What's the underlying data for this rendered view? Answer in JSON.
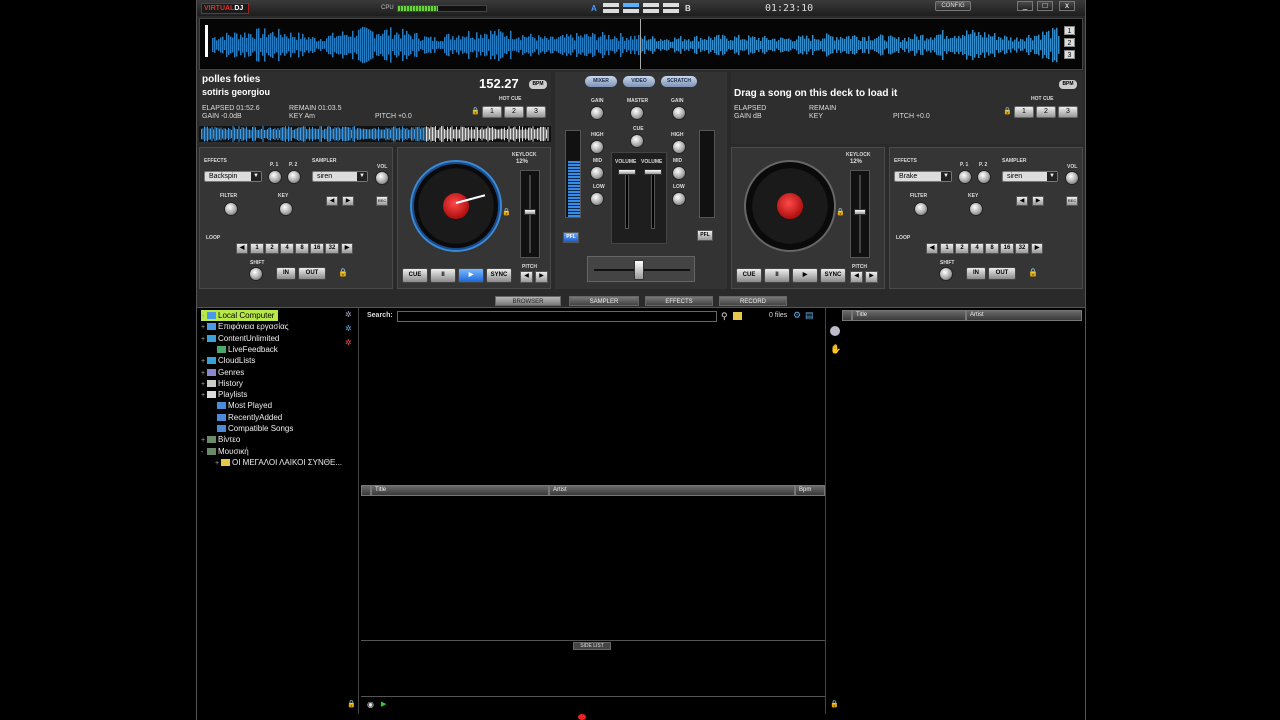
{
  "app": {
    "logo_part1": "VIRTUAL",
    "logo_part2": "DJ",
    "cpu_label": "CPU",
    "cpu_load": 0.45,
    "deck_a_label": "A",
    "deck_b_label": "B",
    "clock": "01:23:10",
    "config_label": "CONFIG",
    "minimize": "_",
    "maximize": "□",
    "close": "x"
  },
  "waveform": {
    "buttons": [
      "1",
      "2",
      "3"
    ]
  },
  "deck_left": {
    "title": "polles foties",
    "artist": "sotiris georgiou",
    "bpm": "152.27",
    "bpm_badge": "BPM",
    "elapsed": "ELAPSED 01:52.6",
    "remain": "REMAIN 01:03.5",
    "gain": "GAIN -0.0dB",
    "key": "KEY Am",
    "pitch": "PITCH +0.0",
    "hot_cue_label": "HOT CUE",
    "hot_cues": [
      "1",
      "2",
      "3"
    ],
    "effects_label": "EFFECTS",
    "p1": "P. 1",
    "p2": "P. 2",
    "effect": "Backspin",
    "sampler_label": "SAMPLER",
    "vol_label": "VOL",
    "sample": "siren",
    "rec": "REC",
    "filter_label": "FILTER",
    "key_label": "KEY",
    "loop_label": "LOOP",
    "loop_values": [
      "1",
      "2",
      "4",
      "8",
      "16",
      "32"
    ],
    "shift_label": "SHIFT",
    "in_label": "IN",
    "out_label": "OUT",
    "keylock_label": "KEYLOCK",
    "keylock_value": "12%",
    "pitch_label": "PITCH",
    "cue": "CUE",
    "pause": "II",
    "play": "▶",
    "sync": "SYNC"
  },
  "deck_right": {
    "title": "Drag a song on this deck to load it",
    "bpm_badge": "BPM",
    "elapsed": "ELAPSED",
    "remain": "REMAIN",
    "gain": "GAIN dB",
    "key": "KEY",
    "pitch": "PITCH +0.0",
    "hot_cue_label": "HOT CUE",
    "hot_cues": [
      "1",
      "2",
      "3"
    ],
    "effects_label": "EFFECTS",
    "p1": "P. 1",
    "p2": "P. 2",
    "effect": "Brake",
    "sampler_label": "SAMPLER",
    "vol_label": "VOL",
    "sample": "siren",
    "rec": "REC",
    "filter_label": "FILTER",
    "key_label": "KEY",
    "loop_label": "LOOP",
    "loop_values": [
      "1",
      "2",
      "4",
      "8",
      "16",
      "32"
    ],
    "shift_label": "SHIFT",
    "in_label": "IN",
    "out_label": "OUT",
    "keylock_label": "KEYLOCK",
    "keylock_value": "12%",
    "pitch_label": "PITCH",
    "cue": "CUE",
    "pause": "II",
    "play": "▶",
    "sync": "SYNC"
  },
  "mixer": {
    "tabs": [
      "MIXER",
      "VIDEO",
      "SCRATCH"
    ],
    "gain": "GAIN",
    "master": "MASTER",
    "high": "HIGH",
    "cue": "CUE",
    "mid": "MID",
    "low": "LOW",
    "volume": "VOLUME",
    "pfl": "PFL"
  },
  "browser_tabs": [
    "BROWSER",
    "SAMPLER",
    "EFFECTS",
    "RECORD"
  ],
  "folders": [
    {
      "label": "Local Computer",
      "plus": "+",
      "color": "#4a9ae8"
    },
    {
      "label": "Επιφάνεια εργασίας",
      "plus": "+",
      "color": "#4a9ae8"
    },
    {
      "label": "ContentUnlimited",
      "plus": "+",
      "color": "#3aa0d8"
    },
    {
      "label": "LiveFeedback",
      "plus": "",
      "color": "#4aa86a"
    },
    {
      "label": "CloudLists",
      "plus": "+",
      "color": "#3aa0d8"
    },
    {
      "label": "Genres",
      "plus": "+",
      "color": "#8888cc"
    },
    {
      "label": "History",
      "plus": "+",
      "color": "#cccccc"
    },
    {
      "label": "Playlists",
      "plus": "+",
      "color": "#dddddd"
    },
    {
      "label": "Most Played",
      "plus": "",
      "color": "#4a8ad8"
    },
    {
      "label": "RecentlyAdded",
      "plus": "",
      "color": "#4a8ad8"
    },
    {
      "label": "Compatible Songs",
      "plus": "",
      "color": "#4a8ad8"
    },
    {
      "label": "Βίντεο",
      "plus": "+",
      "color": "#6a8a6a"
    },
    {
      "label": "Μουσική",
      "plus": "-",
      "color": "#6a8a6a"
    },
    {
      "label": "ΟΙ ΜΕΓΑΛΟΙ ΛΑΙΚΟΙ ΣΥΝΘΕ...",
      "plus": "+",
      "color": "#e8c84a"
    }
  ],
  "search": {
    "label": "Search:",
    "files": "0 files"
  },
  "columns": {
    "title": "Title",
    "artist": "Artist",
    "bpm": "Bpm"
  },
  "sidelist": {
    "label": "SIDE LIST",
    "title": "Title",
    "artist": "Artist"
  }
}
